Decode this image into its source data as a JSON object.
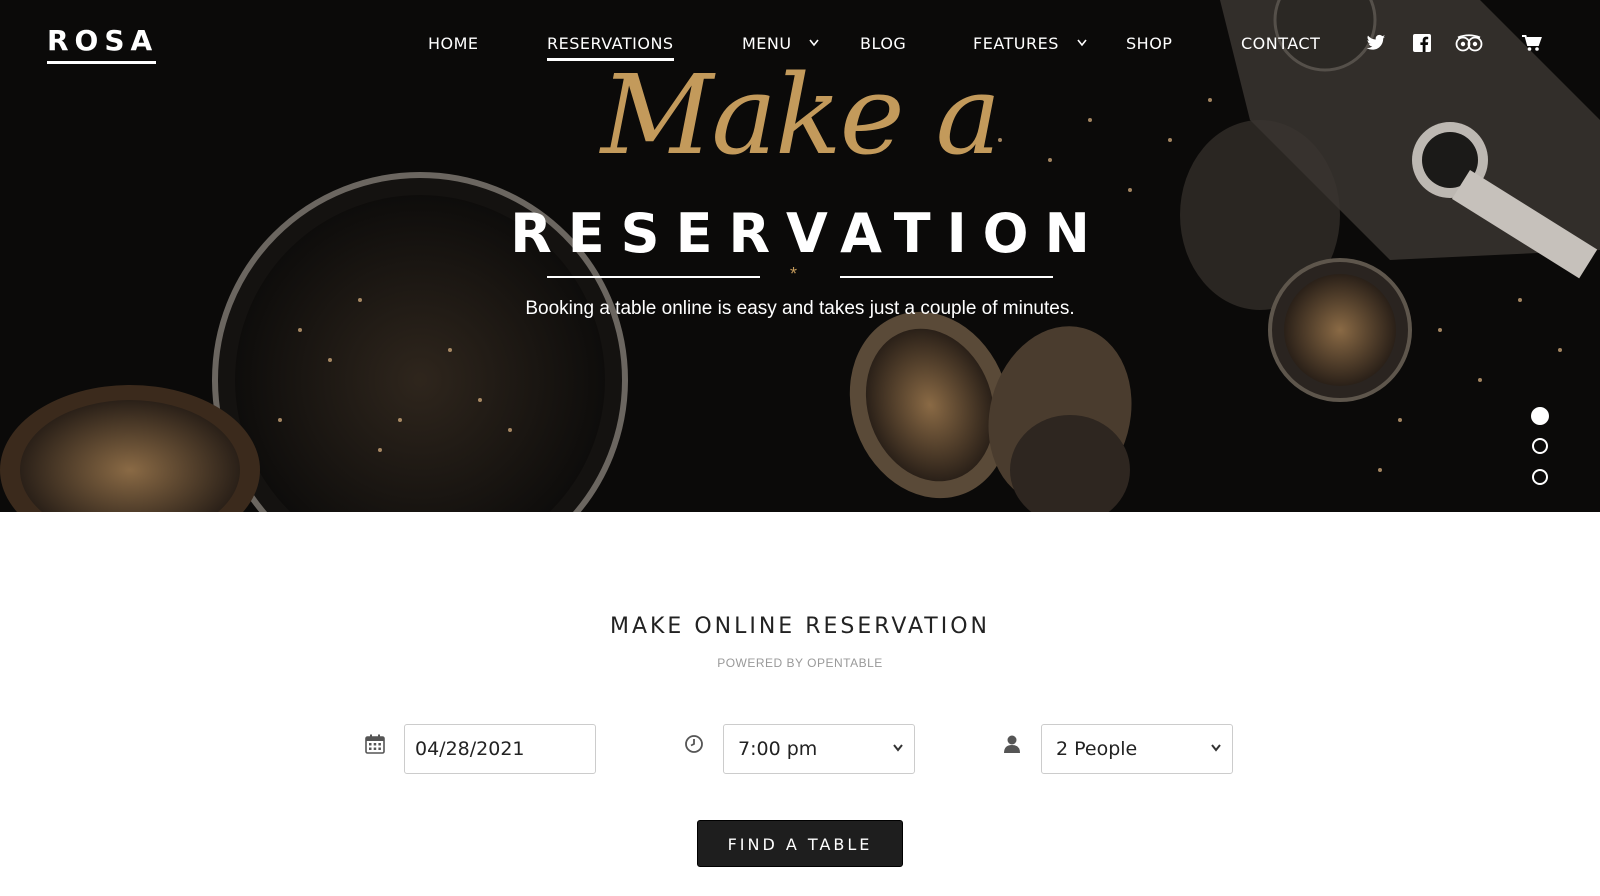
{
  "brand": {
    "logo_text": "ROSA"
  },
  "nav": {
    "items": [
      {
        "label": "HOME"
      },
      {
        "label": "RESERVATIONS",
        "active": true
      },
      {
        "label": "MENU",
        "has_dropdown": true
      },
      {
        "label": "BLOG"
      },
      {
        "label": "FEATURES",
        "has_dropdown": true
      },
      {
        "label": "SHOP"
      },
      {
        "label": "CONTACT"
      }
    ],
    "icons": [
      "twitter-icon",
      "facebook-icon",
      "tripadvisor-icon",
      "cart-icon"
    ]
  },
  "hero": {
    "script_title": "Make a",
    "title": "RESERVATION",
    "divider_glyph": "*",
    "subtitle": "Booking a table online is easy and takes just a couple of minutes.",
    "slides_total": 3,
    "active_slide": 1
  },
  "reservation": {
    "title": "MAKE ONLINE RESERVATION",
    "powered_by": "POWERED BY OPENTABLE",
    "date": {
      "icon": "calendar-icon",
      "value": "04/28/2021"
    },
    "time": {
      "icon": "clock-icon",
      "value": "7:00 pm"
    },
    "party": {
      "icon": "person-icon",
      "value": "2 People"
    },
    "submit_label": "FIND A TABLE"
  },
  "colors": {
    "accent_gold": "#c39a5b",
    "hero_bg": "#0b0a09",
    "button_bg": "#1e1e1e"
  }
}
